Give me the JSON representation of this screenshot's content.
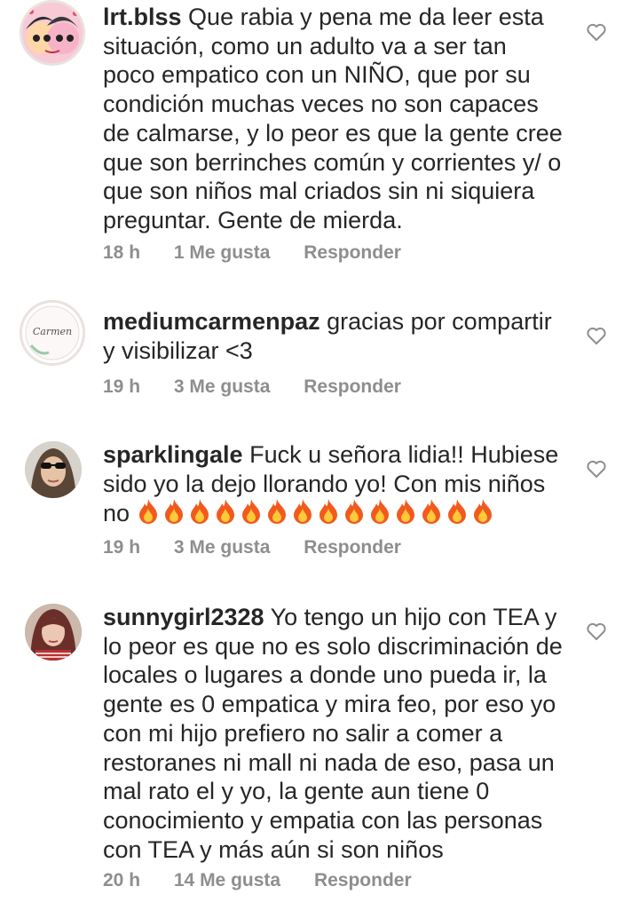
{
  "comments": [
    {
      "username": "lrt.blss",
      "text": "Que rabia y pena me da leer esta situación, como un adulto va a ser tan poco empatico con un NIÑO, que por su condición muchas veces no son capaces de calmarse, y lo peor es que la gente cree que son berrinches común y corrientes y/ o que son niños mal criados sin ni siquiera preguntar. Gente de mierda.",
      "time": "18 h",
      "likes": "1 Me gusta",
      "reply": "Responder"
    },
    {
      "username": "mediumcarmenpaz",
      "text": "gracias por compartir y visibilizar <3",
      "time": "19 h",
      "likes": "3 Me gusta",
      "reply": "Responder",
      "avatar_text": "Carmen"
    },
    {
      "username": "sparklingale",
      "text": "Fuck u señora lidia!! Hubiese sido yo la dejo llorando yo! Con mis niños no",
      "emoji": "fire-icon",
      "emoji_count": 14,
      "time": "19 h",
      "likes": "3 Me gusta",
      "reply": "Responder"
    },
    {
      "username": "sunnygirl2328",
      "text": "Yo tengo un hijo con TEA y lo peor es que no es solo discriminación de locales o lugares a donde uno pueda ir, la gente es 0 empatica y mira feo, por eso yo con mi hijo prefiero no salir a comer a restoranes ni mall ni nada de eso, pasa un mal rato el y yo, la gente aun tiene 0 conocimiento y empatia con las personas con TEA y más aún si son niños",
      "time": "20 h",
      "likes": "14 Me gusta",
      "reply": "Responder"
    }
  ],
  "colors": {
    "text": "#262626",
    "meta": "#8e8e8e",
    "heart": "#8e8e8e"
  }
}
